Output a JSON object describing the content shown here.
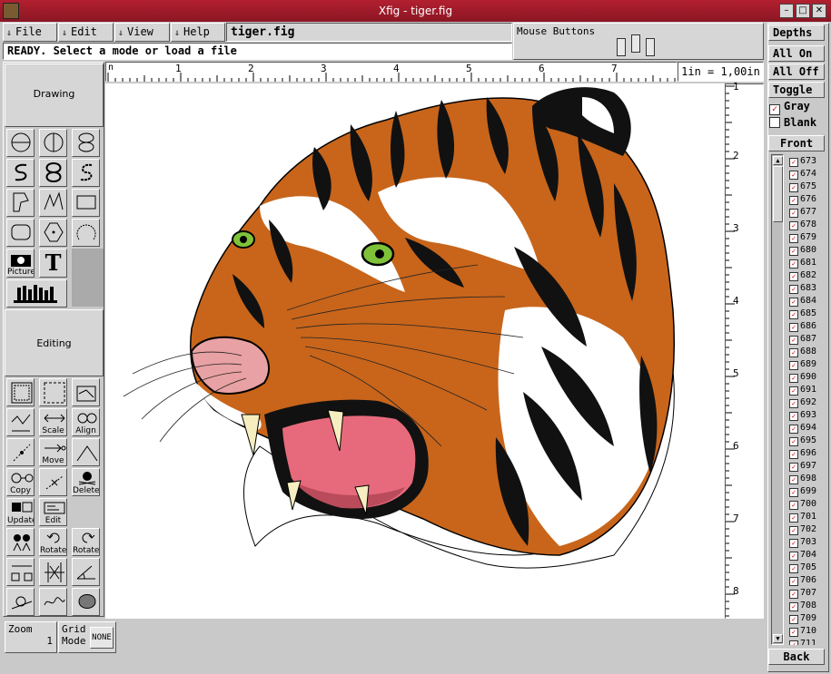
{
  "window": {
    "title": "Xfig - tiger.fig",
    "minimize_label": "–",
    "maximize_label": "□",
    "close_label": "✕"
  },
  "menu": {
    "file": "File",
    "edit": "Edit",
    "view": "View",
    "help": "Help"
  },
  "filename": "tiger.fig",
  "status": "READY. Select a mode or load a file",
  "mouse_buttons_label": "Mouse Buttons",
  "ruler": {
    "top_ticks": [
      "n",
      "1",
      "2",
      "3",
      "4",
      "5",
      "6",
      "7"
    ],
    "unit": "1in = 1,00in",
    "left_ticks": [
      "1",
      "2",
      "3",
      "4",
      "5",
      "6",
      "7",
      "8"
    ]
  },
  "left_panel": {
    "drawing_label": "Drawing",
    "editing_label": "Editing",
    "picture_label": "Picture",
    "text_label": "T",
    "edit_modes": {
      "scale": "Scale",
      "align": "Align",
      "move": "Move",
      "copy": "Copy",
      "delete": "Delete",
      "update": "Update",
      "edit": "Edit",
      "rotate1": "Rotate",
      "rotate2": "Rotate"
    }
  },
  "bottom": {
    "zoom_label": "Zoom",
    "zoom_value": "1",
    "grid_label": "Grid",
    "mode_label": "Mode",
    "grid_value": "NONE"
  },
  "right_panel": {
    "depths": "Depths",
    "all_on": "All On",
    "all_off": "All Off",
    "toggle": "Toggle",
    "gray": "Gray",
    "blank": "Blank",
    "front": "Front",
    "back": "Back",
    "depth_items": [
      "673",
      "674",
      "675",
      "676",
      "677",
      "678",
      "679",
      "680",
      "681",
      "682",
      "683",
      "684",
      "685",
      "686",
      "687",
      "688",
      "689",
      "690",
      "691",
      "692",
      "693",
      "694",
      "695",
      "696",
      "697",
      "698",
      "699",
      "700",
      "701",
      "702",
      "703",
      "704",
      "705",
      "706",
      "707",
      "708",
      "709",
      "710",
      "711"
    ]
  },
  "colors": {
    "title_bar": "#a11c2c",
    "tiger_orange": "#c8651b",
    "tiger_black": "#111111",
    "eye_green": "#7fc23a",
    "mouth_pink": "#e76a7c"
  }
}
